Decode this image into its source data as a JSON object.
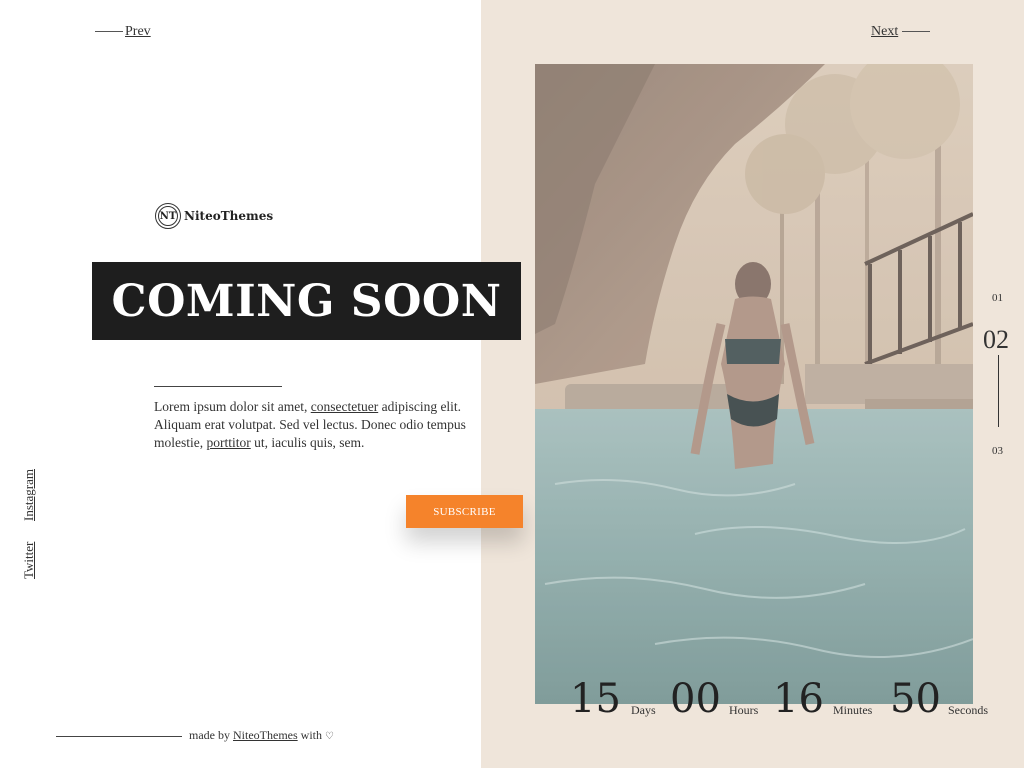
{
  "nav": {
    "prev_label": "Prev",
    "next_label": "Next"
  },
  "brand": {
    "badge": "NT",
    "name": "NiteoThemes"
  },
  "hero": {
    "title": "COMING SOON"
  },
  "intro": {
    "part1": "Lorem ipsum dolor sit amet, ",
    "link1": "consectetuer",
    "part2": " adipiscing elit. Aliquam erat volutpat. Sed vel lectus. Donec odio tempus molestie, ",
    "link2": "porttitor",
    "part3": " ut, iaculis quis, sem."
  },
  "subscribe_label": "SUBSCRIBE",
  "social": {
    "instagram": "Instagram",
    "twitter": "Twitter"
  },
  "slides": {
    "prev": "01",
    "current": "02",
    "next": "03"
  },
  "countdown": {
    "days": "15",
    "days_label": "Days",
    "hours": "00",
    "hours_label": "Hours",
    "minutes": "16",
    "minutes_label": "Minutes",
    "seconds": "50",
    "seconds_label": "Seconds"
  },
  "footer": {
    "prefix": "made by ",
    "link": "NiteoThemes",
    "suffix": " with "
  },
  "colors": {
    "accent": "#f5832b",
    "panel": "#efe5da",
    "title_bg": "#1e1e1e"
  }
}
